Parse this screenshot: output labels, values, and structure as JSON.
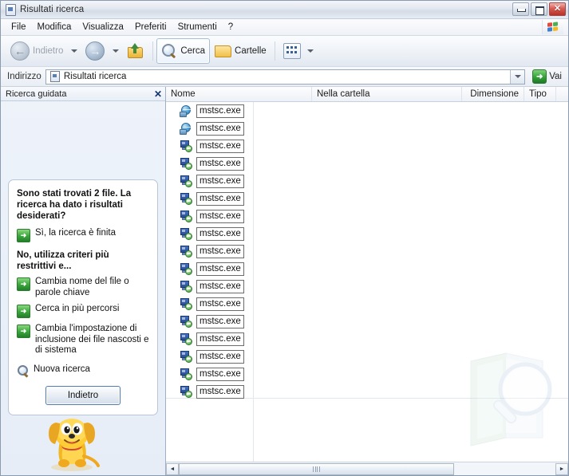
{
  "window": {
    "title": "Risultati ricerca",
    "title_icon": "search-results-document-icon",
    "minimize_label": "_",
    "maximize_label": "□",
    "close_label": "✕"
  },
  "menu": {
    "items": [
      {
        "label": "File"
      },
      {
        "label": "Modifica"
      },
      {
        "label": "Visualizza"
      },
      {
        "label": "Preferiti"
      },
      {
        "label": "Strumenti"
      },
      {
        "label": "?"
      }
    ],
    "brand_icon": "windows-flag-icon"
  },
  "toolbar": {
    "back_label": "Indietro",
    "back_icon": "back-arrow-icon",
    "forward_icon": "forward-arrow-icon",
    "up_icon": "up-folder-icon",
    "search_label": "Cerca",
    "search_icon": "magnifier-icon",
    "folders_label": "Cartelle",
    "folders_icon": "folder-icon",
    "views_icon": "views-icon",
    "dropdown_icon": "chevron-down-icon"
  },
  "address": {
    "label": "Indirizzo",
    "value": "Risultati ricerca",
    "icon": "search-results-document-icon",
    "dropdown_icon": "chevron-down-icon",
    "go_label": "Vai",
    "go_icon": "green-arrow-icon"
  },
  "search_pane": {
    "header_title": "Ricerca guidata",
    "close_icon": "close-icon",
    "question": "Sono stati trovati 2 file. La ricerca ha dato i risultati desiderati?",
    "yes_option": {
      "label": "Sì, la ricerca è finita",
      "icon": "green-arrow-icon"
    },
    "no_heading": "No, utilizza criteri più restrittivi e...",
    "options": [
      {
        "label": "Cambia nome del file o parole chiave",
        "icon": "green-arrow-icon"
      },
      {
        "label": "Cerca in più percorsi",
        "icon": "green-arrow-icon"
      },
      {
        "label": "Cambia l'impostazione di inclusione dei file nascosti e di sistema",
        "icon": "green-arrow-icon"
      },
      {
        "label": "Nuova ricerca",
        "icon": "magnifier-icon"
      }
    ],
    "back_button": "Indietro",
    "assistant_icon": "search-dog-rover-icon"
  },
  "file_list": {
    "columns": [
      {
        "key": "nome",
        "label": "Nome"
      },
      {
        "key": "cartella",
        "label": "Nella cartella"
      },
      {
        "key": "dimensione",
        "label": "Dimensione"
      },
      {
        "key": "tipo",
        "label": "Tipo"
      }
    ],
    "rows": [
      {
        "nome": "mstsc.exe",
        "icon": "remote-desktop-globe-icon",
        "cartella": "",
        "dimensione": "",
        "tipo": ""
      },
      {
        "nome": "mstsc.exe",
        "icon": "remote-desktop-globe-icon",
        "cartella": "",
        "dimensione": "",
        "tipo": ""
      },
      {
        "nome": "mstsc.exe",
        "icon": "remote-desktop-monitor-icon",
        "cartella": "",
        "dimensione": "",
        "tipo": ""
      },
      {
        "nome": "mstsc.exe",
        "icon": "remote-desktop-monitor-icon",
        "cartella": "",
        "dimensione": "",
        "tipo": ""
      },
      {
        "nome": "mstsc.exe",
        "icon": "remote-desktop-monitor-icon",
        "cartella": "",
        "dimensione": "",
        "tipo": ""
      },
      {
        "nome": "mstsc.exe",
        "icon": "remote-desktop-monitor-icon",
        "cartella": "",
        "dimensione": "",
        "tipo": ""
      },
      {
        "nome": "mstsc.exe",
        "icon": "remote-desktop-monitor-icon",
        "cartella": "",
        "dimensione": "",
        "tipo": ""
      },
      {
        "nome": "mstsc.exe",
        "icon": "remote-desktop-monitor-icon",
        "cartella": "",
        "dimensione": "",
        "tipo": ""
      },
      {
        "nome": "mstsc.exe",
        "icon": "remote-desktop-monitor-icon",
        "cartella": "",
        "dimensione": "",
        "tipo": ""
      },
      {
        "nome": "mstsc.exe",
        "icon": "remote-desktop-monitor-icon",
        "cartella": "",
        "dimensione": "",
        "tipo": ""
      },
      {
        "nome": "mstsc.exe",
        "icon": "remote-desktop-monitor-icon",
        "cartella": "",
        "dimensione": "",
        "tipo": ""
      },
      {
        "nome": "mstsc.exe",
        "icon": "remote-desktop-monitor-icon",
        "cartella": "",
        "dimensione": "",
        "tipo": ""
      },
      {
        "nome": "mstsc.exe",
        "icon": "remote-desktop-monitor-icon",
        "cartella": "",
        "dimensione": "",
        "tipo": ""
      },
      {
        "nome": "mstsc.exe",
        "icon": "remote-desktop-monitor-icon",
        "cartella": "",
        "dimensione": "",
        "tipo": ""
      },
      {
        "nome": "mstsc.exe",
        "icon": "remote-desktop-monitor-icon",
        "cartella": "",
        "dimensione": "",
        "tipo": ""
      },
      {
        "nome": "mstsc.exe",
        "icon": "remote-desktop-monitor-icon",
        "cartella": "",
        "dimensione": "",
        "tipo": ""
      },
      {
        "nome": "mstsc.exe",
        "icon": "remote-desktop-monitor-icon",
        "cartella": "",
        "dimensione": "",
        "tipo": ""
      }
    ],
    "watermark_icon": "folder-with-magnifier-watermark"
  },
  "scrollbar": {
    "left_arrow": "◄",
    "right_arrow": "►"
  },
  "colors": {
    "accent_blue": "#3a5f92",
    "green_arrow": "#35a13a",
    "close_red": "#b83127",
    "pane_bg": "#eef3fa"
  }
}
